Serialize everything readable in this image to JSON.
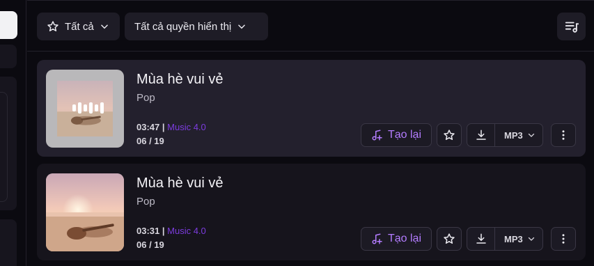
{
  "filters": {
    "all_label": "Tất cả",
    "visibility_label": "Tất cả quyền hiển thị"
  },
  "icons": {
    "star": "star-icon",
    "chevron": "chevron-down-icon",
    "sort": "sort-list-icon",
    "remake": "music-plus-icon",
    "download": "download-icon",
    "more": "more-vertical-icon"
  },
  "colors": {
    "accent": "#b37cff",
    "model": "#7c3cde",
    "card_active": "#23202d",
    "card": "#16141c"
  },
  "songs": [
    {
      "title": "Mùa hè vui vẻ",
      "genre": "Pop",
      "duration": "03:47",
      "separator": "|",
      "model": "Music 4.0",
      "count": "06 / 19",
      "remake_label": "Tạo lại",
      "format": "MP3",
      "playing": true
    },
    {
      "title": "Mùa hè vui vẻ",
      "genre": "Pop",
      "duration": "03:31",
      "separator": "|",
      "model": "Music 4.0",
      "count": "06 / 19",
      "remake_label": "Tạo lại",
      "format": "MP3",
      "playing": false
    }
  ]
}
